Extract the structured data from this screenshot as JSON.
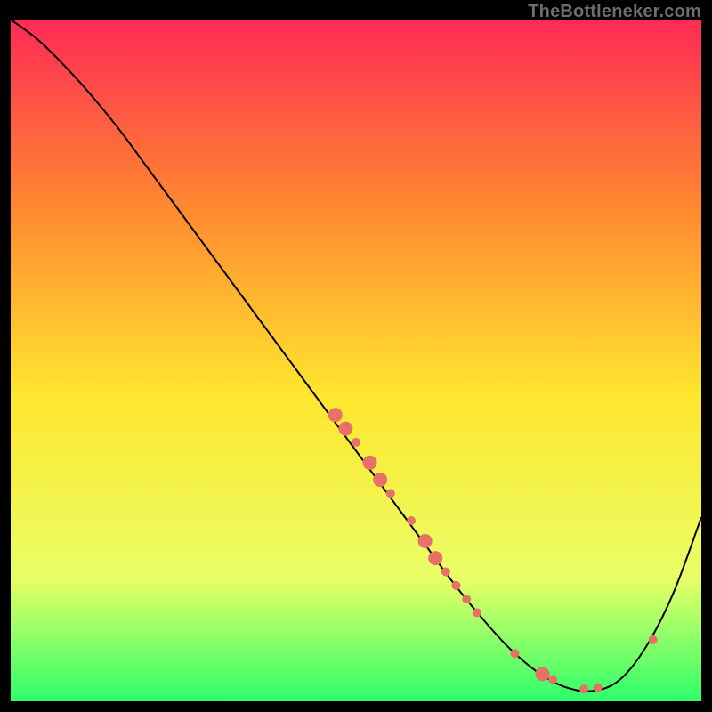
{
  "watermark": "TheBottleneker.com",
  "chart_data": {
    "type": "line",
    "title": "",
    "xlabel": "",
    "ylabel": "",
    "xlim": [
      0,
      100
    ],
    "ylim": [
      0,
      100
    ],
    "background_gradient": {
      "top": "#ff2a55",
      "upper_mid": "#ff8a30",
      "mid": "#ffe62e",
      "lower_mid": "#e8ff66",
      "bottom": "#2cff6a"
    },
    "series": [
      {
        "name": "bottleneck-curve",
        "x": [
          0,
          4,
          8,
          12,
          16,
          20,
          24,
          28,
          32,
          36,
          40,
          44,
          48,
          52,
          56,
          60,
          64,
          68,
          72,
          76,
          80,
          84,
          88,
          92,
          96,
          100
        ],
        "y": [
          100,
          97,
          93,
          88.5,
          83.5,
          78,
          72.5,
          67,
          61.5,
          56,
          50.5,
          45,
          39.5,
          34,
          28.5,
          23,
          17.5,
          12.5,
          8,
          4.5,
          2.2,
          1.5,
          3,
          8,
          16,
          27
        ],
        "stroke": "#000000",
        "stroke_width": 2
      }
    ],
    "scatter_points": {
      "name": "highlight-dots",
      "fill": "#e77169",
      "r_small": 5,
      "r_large": 8,
      "points": [
        {
          "x": 47,
          "y": 42,
          "r": 8
        },
        {
          "x": 48.5,
          "y": 40,
          "r": 8
        },
        {
          "x": 50,
          "y": 38,
          "r": 5
        },
        {
          "x": 52,
          "y": 35,
          "r": 8
        },
        {
          "x": 53.5,
          "y": 32.5,
          "r": 8
        },
        {
          "x": 55,
          "y": 30.5,
          "r": 5
        },
        {
          "x": 58,
          "y": 26.5,
          "r": 5
        },
        {
          "x": 60,
          "y": 23.5,
          "r": 8
        },
        {
          "x": 61.5,
          "y": 21,
          "r": 8
        },
        {
          "x": 63,
          "y": 19,
          "r": 5
        },
        {
          "x": 64.5,
          "y": 17,
          "r": 5
        },
        {
          "x": 66,
          "y": 15,
          "r": 5
        },
        {
          "x": 67.5,
          "y": 13,
          "r": 5
        },
        {
          "x": 73,
          "y": 7,
          "r": 5
        },
        {
          "x": 77,
          "y": 4,
          "r": 8
        },
        {
          "x": 78.5,
          "y": 3.2,
          "r": 5
        },
        {
          "x": 83,
          "y": 1.8,
          "r": 5
        },
        {
          "x": 85,
          "y": 2,
          "r": 5
        },
        {
          "x": 93,
          "y": 9,
          "r": 5
        }
      ]
    }
  }
}
